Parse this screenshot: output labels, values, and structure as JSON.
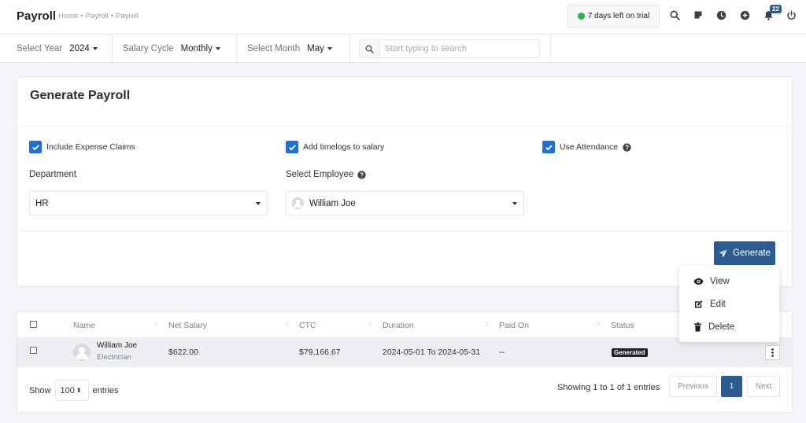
{
  "header": {
    "title": "Payroll",
    "breadcrumb": [
      "Home",
      "Payroll",
      "Payroll"
    ],
    "trial_text": "7 days left on trial",
    "notification_count": "22",
    "icons": [
      "search-icon",
      "sticky-note-icon",
      "clock-icon",
      "plus-circle-icon",
      "bell-icon",
      "power-icon"
    ]
  },
  "filters": {
    "year_label": "Select Year",
    "year_value": "2024",
    "cycle_label": "Salary Cycle",
    "cycle_value": "Monthly",
    "month_label": "Select Month",
    "month_value": "May",
    "search_placeholder": "Start typing to search"
  },
  "generate": {
    "title": "Generate Payroll",
    "include_expense_label": "Include Expense Claims",
    "timelogs_label": "Add timelogs to salary",
    "attendance_label": "Use Attendance",
    "department_label": "Department",
    "department_value": "HR",
    "employee_label": "Select Employee",
    "employee_value": "William Joe",
    "button_label": "Generate"
  },
  "table": {
    "columns": [
      "Name",
      "Net Salary",
      "CTC",
      "Duration",
      "Paid On",
      "Status"
    ],
    "rows": [
      {
        "name": "William Joe",
        "designation": "Electrician",
        "net_salary": "$622.00",
        "ctc": "$79,166.67",
        "duration": "2024-05-01 To 2024-05-31",
        "paid_on": "--",
        "status": "Generated"
      }
    ],
    "show_label": "Show",
    "entries_value": "100",
    "entries_label": "entries",
    "info": "Showing 1 to 1 of 1 entries",
    "prev_label": "Previous",
    "page": "1",
    "next_label": "Next"
  },
  "action_menu": {
    "items": [
      "View",
      "Edit",
      "Delete"
    ]
  },
  "colors": {
    "primary": "#2b5b8f",
    "checkbox": "#1e6fd9",
    "trial_dot": "#2bb24c"
  }
}
